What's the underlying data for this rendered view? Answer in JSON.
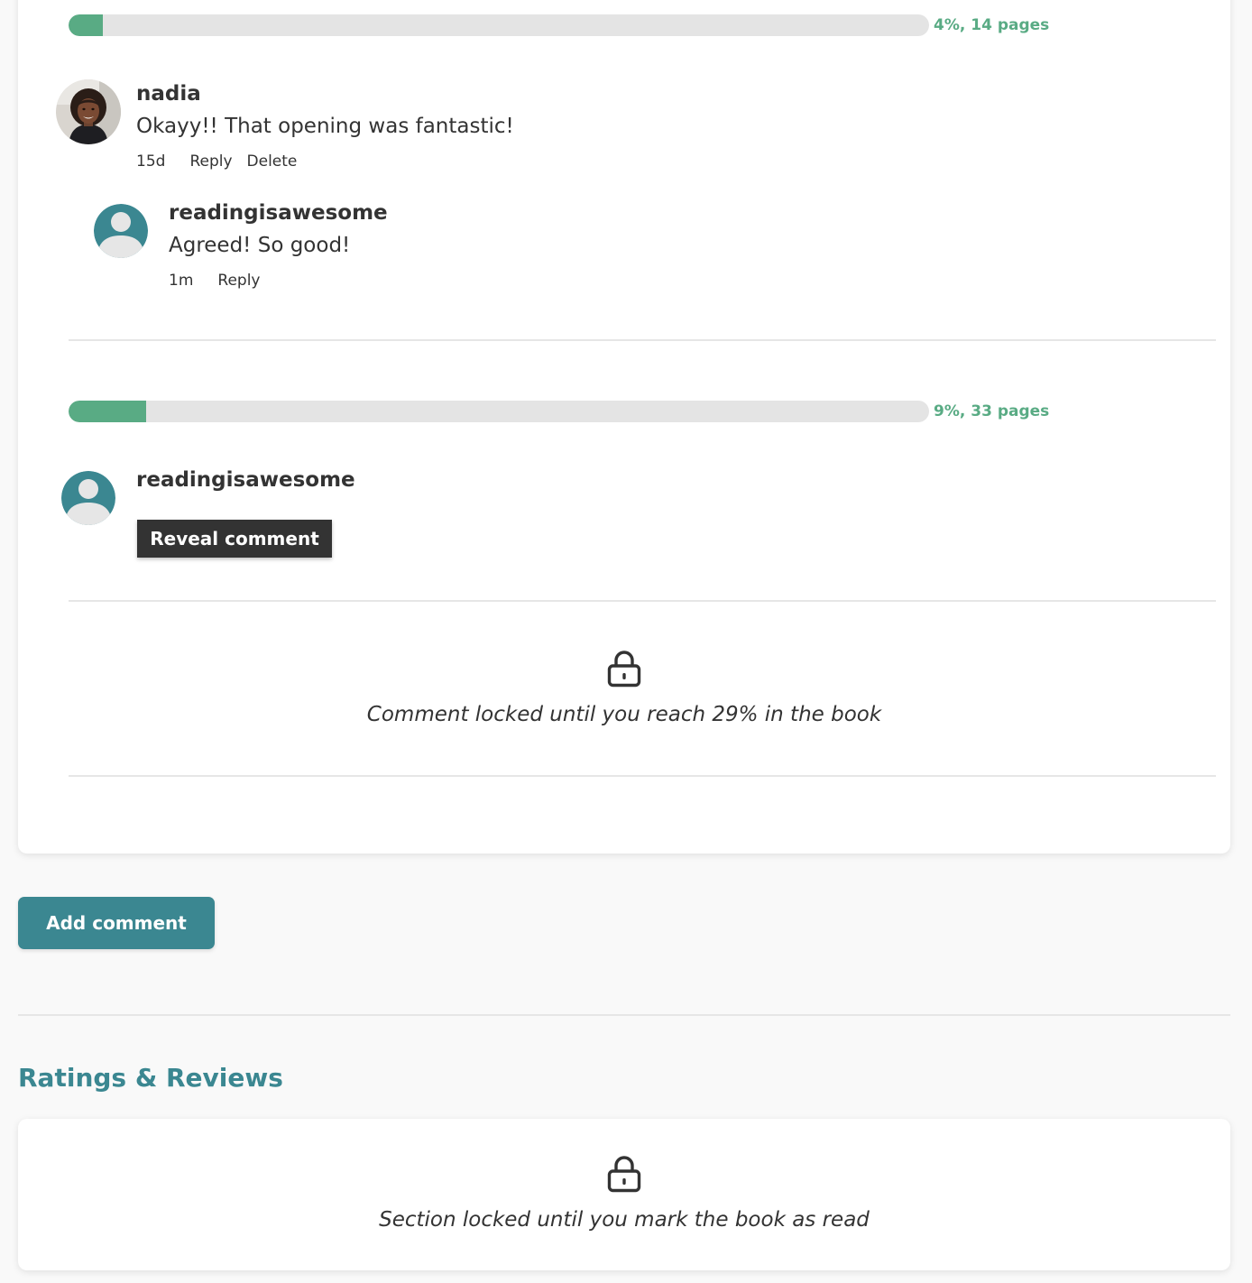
{
  "comments_section": {
    "groups": [
      {
        "progress": {
          "percent": 4,
          "label": "4%, 14 pages"
        },
        "comment": {
          "username": "nadia",
          "avatar": "user-photo",
          "text": "Okayy!! That opening was fantastic!",
          "time": "15d",
          "actions": [
            "Reply",
            "Delete"
          ]
        },
        "reply": {
          "username": "readingisawesome",
          "avatar": "default-user-icon",
          "text": "Agreed! So good!",
          "time": "1m",
          "actions": [
            "Reply"
          ]
        }
      },
      {
        "progress": {
          "percent": 9,
          "label": "9%, 33 pages"
        },
        "comment": {
          "username": "readingisawesome",
          "avatar": "default-user-icon",
          "reveal_label": "Reveal comment"
        }
      }
    ],
    "locked_comment": {
      "icon": "lock-icon",
      "text": "Comment locked until you reach 29% in the book"
    }
  },
  "add_comment": {
    "label": "Add comment"
  },
  "ratings_reviews": {
    "heading": "Ratings & Reviews",
    "locked": {
      "icon": "lock-icon",
      "text": "Section locked until you mark the book as read"
    }
  },
  "colors": {
    "accent": "#3b8791",
    "progress_fill": "#59ab84",
    "progress_track": "#e4e4e4",
    "dark_button": "#333333"
  }
}
